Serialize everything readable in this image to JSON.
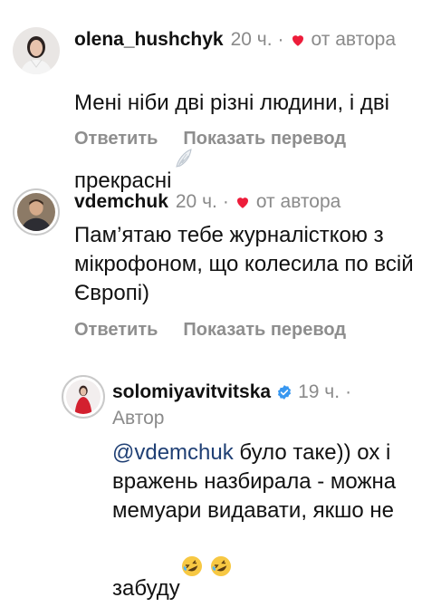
{
  "comments": [
    {
      "username": "olena_hushchyk",
      "time": "20 ч.",
      "dot": "·",
      "by_author": "от автора",
      "text": "Мені ніби дві різні людини, і дві прекрасні",
      "emoji": "wing-emoji",
      "actions": {
        "reply": "Ответить",
        "translate": "Показать перевод"
      }
    },
    {
      "username": "vdemchuk",
      "time": "20 ч.",
      "dot": "·",
      "by_author": "от автора",
      "text": "Пам’ятаю тебе журналісткою з мікрофоном, що колесила по всій Європі)",
      "actions": {
        "reply": "Ответить",
        "translate": "Показать перевод"
      }
    }
  ],
  "reply": {
    "username": "solomiyavitvitska",
    "time": "19 ч.",
    "dot": "·",
    "author_label": "Автор",
    "mention": "@vdemchuk",
    "text": " було таке)) ох і вражень назбирала - можна мемуари видавати, якшо не забуду",
    "emojis": [
      "rofl-emoji",
      "rofl-emoji"
    ]
  },
  "colors": {
    "heart": "#ed1c3a",
    "verified": "#3897f0",
    "mention": "#1f3f74",
    "muted": "#8a8a8a"
  }
}
